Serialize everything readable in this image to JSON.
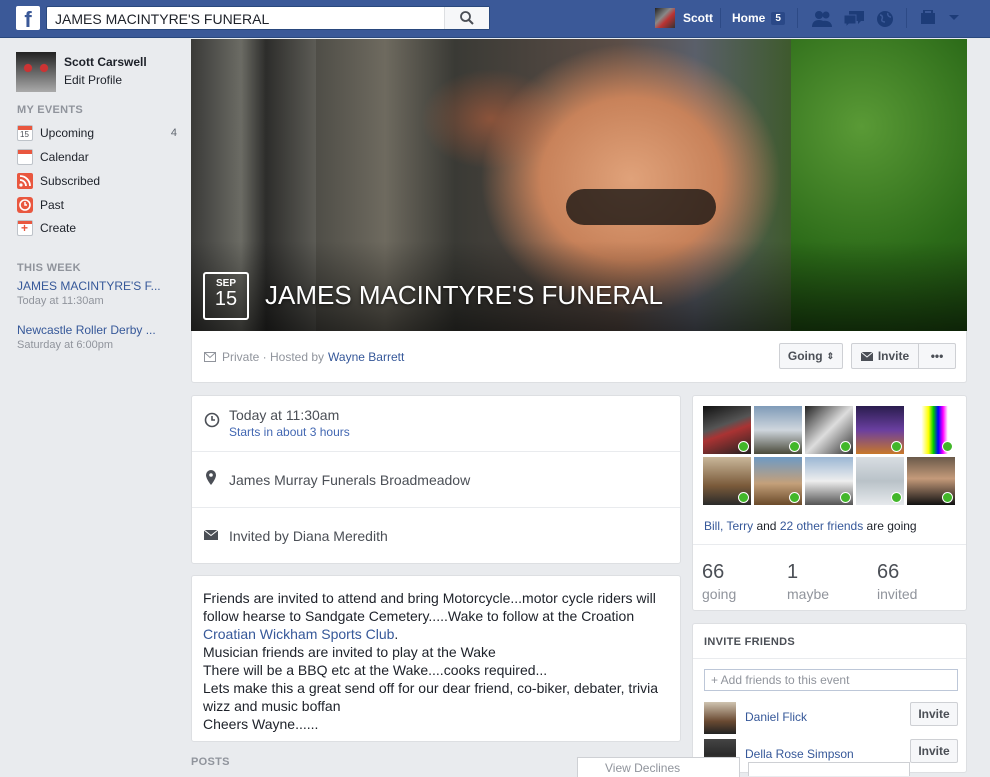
{
  "topbar": {
    "logo": "f",
    "search_value": "JAMES MACINTYRE'S FUNERAL",
    "user_name": "Scott",
    "home_label": "Home",
    "home_count": "5"
  },
  "sidebar": {
    "user_name": "Scott Carswell",
    "edit_profile": "Edit Profile",
    "my_events_title": "MY EVENTS",
    "items": [
      {
        "label": "Upcoming",
        "count": "4",
        "icon": "calendar-15-icon"
      },
      {
        "label": "Calendar",
        "icon": "calendar-icon"
      },
      {
        "label": "Subscribed",
        "icon": "rss-icon"
      },
      {
        "label": "Past",
        "icon": "clock-icon"
      },
      {
        "label": "Create",
        "icon": "plus-icon"
      }
    ],
    "this_week_title": "THIS WEEK",
    "week_events": [
      {
        "title": "JAMES MACINTYRE'S F...",
        "time": "Today at 11:30am"
      },
      {
        "title": "Newcastle Roller Derby ...",
        "time": "Saturday at 6:00pm"
      }
    ]
  },
  "event": {
    "month": "SEP",
    "day": "15",
    "title": "JAMES MACINTYRE'S FUNERAL",
    "privacy": "Private · Hosted by",
    "host": "Wayne Barrett",
    "going_button": "Going",
    "invite_button": "Invite",
    "more_button": "•••"
  },
  "details": {
    "time_main": "Today at 11:30am",
    "time_sub": "Starts in about 3 hours",
    "location": "James Murray Funerals Broadmeadow",
    "invited_by": "Invited by Diana Meredith"
  },
  "about": {
    "line1": "Friends are invited to attend and bring Motorcycle...motor cycle riders will",
    "line2": "follow hearse to Sandgate Cemetery.....Wake to follow at the Croation",
    "line3_link": "Croatian Wickham Sports Club",
    "line3_tail": ".",
    "line4": "Musician friends are invited to play at the Wake",
    "line5": "There will be a BBQ etc at the Wake....cooks required...",
    "line6": "Lets make this a great send off for our dear friend, co-biker, debater, trivia",
    "line7": "wizz and music boffan",
    "line8": "Cheers Wayne......"
  },
  "guests": {
    "names_link": "Bill, Terry",
    "and": " and ",
    "others_link": "22 other friends",
    "are_going": " are going",
    "stats": [
      {
        "num": "66",
        "label": "going"
      },
      {
        "num": "1",
        "label": "maybe"
      },
      {
        "num": "66",
        "label": "invited"
      }
    ]
  },
  "invite": {
    "title": "INVITE FRIENDS",
    "placeholder": "+ Add friends to this event",
    "friends": [
      {
        "name": "Daniel Flick",
        "button": "Invite"
      },
      {
        "name": "Della Rose Simpson",
        "button": "Invite"
      }
    ]
  },
  "posts": {
    "label": "POSTS",
    "view_declines": "View Declines"
  },
  "colors": {
    "topbar": "#3b5998",
    "link": "#365899",
    "check": "#42b72a"
  }
}
